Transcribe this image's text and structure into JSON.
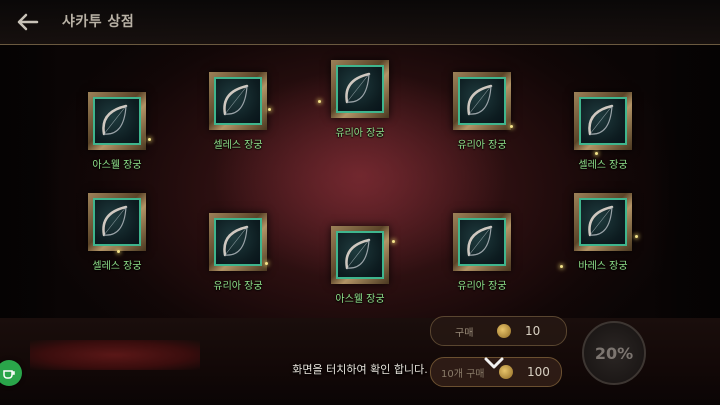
{
  "header": {
    "title": "샤카투 상점"
  },
  "items": [
    {
      "name": "아스웰 장궁"
    },
    {
      "name": "셀레스 장궁"
    },
    {
      "name": "유리아 장궁"
    },
    {
      "name": "유리아 장궁"
    },
    {
      "name": "셀레스 장궁"
    },
    {
      "name": "셀레스 장궁"
    },
    {
      "name": "유리아 장궁"
    },
    {
      "name": "아스웰 장궁"
    },
    {
      "name": "유리아 장궁"
    },
    {
      "name": "바레스 장궁"
    }
  ],
  "buy": {
    "label": "구매",
    "count": "10"
  },
  "buy10": {
    "label": "10개 구매",
    "count": "100"
  },
  "discount": "20%",
  "hint": "화면을 터치하여 확인 합니다.",
  "icons": {
    "back": "arrow-left-icon",
    "bow": "bow-icon",
    "coin": "coin-icon",
    "chat": "chat-icon",
    "chevron": "chevron-down-icon"
  },
  "colors": {
    "item_name": "#8fe08a",
    "slot_border": "#3fb58d",
    "frame_gold": "#9c8158"
  }
}
